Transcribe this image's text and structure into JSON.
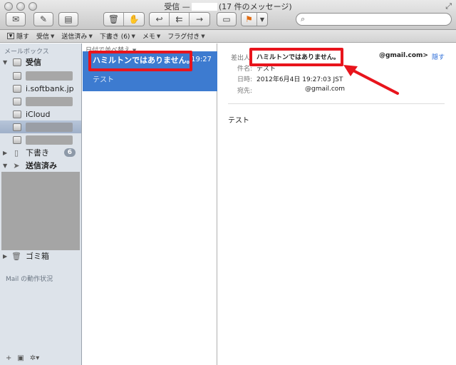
{
  "window": {
    "title_prefix": "受信 —",
    "title_suffix": "(17 件のメッセージ)",
    "search_placeholder": ""
  },
  "toolbar_icons": [
    "envelope-icon",
    "compose-icon",
    "note-icon",
    "trash-icon",
    "junk-icon",
    "reply-icon",
    "reply-all-icon",
    "forward-icon",
    "archive-icon",
    "flag-icon"
  ],
  "favorites_bar": {
    "hide": "隠す",
    "items": [
      "受信",
      "送信済み",
      "下書き (6)",
      "メモ",
      "フラグ付き"
    ]
  },
  "sidebar": {
    "heading": "メールボックス",
    "inbox": "受信",
    "accounts": [
      "",
      "i.softbank.jp",
      "",
      "iCloud",
      "",
      ""
    ],
    "drafts": "下書き",
    "drafts_count": "6",
    "sent": "送信済み",
    "trash": "ゴミ箱",
    "activity": "Mail の動作状況"
  },
  "list": {
    "sort_label": "日付で並べ替え",
    "selected_message": {
      "from": "ハミルトンではありません。",
      "time": "19:27",
      "preview": "テスト"
    }
  },
  "reading_pane": {
    "from_label": "差出人:",
    "from_name": "ハミルトンではありません。",
    "from_email": "@gmail.com>",
    "hide_link": "隠す",
    "subject_label": "件名:",
    "subject_value": "テスト",
    "date_label": "日時:",
    "date_value": "2012年6月4日 19:27:03 JST",
    "to_label": "宛先:",
    "to_value": "@gmail.com",
    "body": "テスト"
  },
  "colors": {
    "highlight_red": "#e8141c",
    "selection_blue": "#3d7bd0",
    "sidebar_bg": "#dde3ea"
  }
}
